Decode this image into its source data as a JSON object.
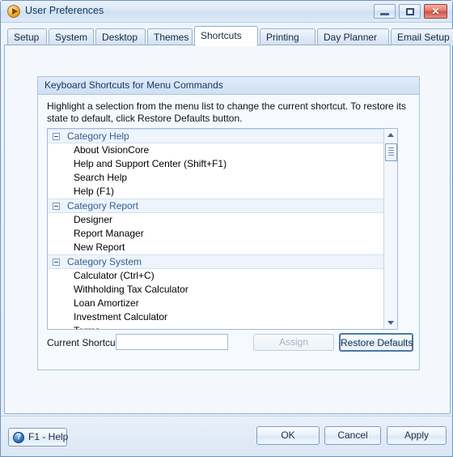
{
  "window": {
    "title": "User Preferences",
    "icon": "play-circle-icon",
    "controls": {
      "minimize": "minimize-icon",
      "maximize": "maximize-icon",
      "close": "✕"
    }
  },
  "tabs": [
    {
      "label": "Setup",
      "active": false
    },
    {
      "label": "System",
      "active": false
    },
    {
      "label": "Desktop",
      "active": false
    },
    {
      "label": "Themes",
      "active": false
    },
    {
      "label": "Shortcuts",
      "active": true
    },
    {
      "label": "Printing",
      "active": false
    },
    {
      "label": "Day Planner",
      "active": false
    },
    {
      "label": "Email Setup",
      "active": false
    }
  ],
  "groupbox": {
    "title": "Keyboard Shortcuts for Menu Commands",
    "description": "Highlight a selection from the menu list to change the current shortcut. To restore its state to default, click Restore Defaults button."
  },
  "tree": {
    "rows": [
      {
        "type": "category",
        "label": "Category Help"
      },
      {
        "type": "item",
        "label": "About VisionCore"
      },
      {
        "type": "item",
        "label": "Help and Support Center (Shift+F1)"
      },
      {
        "type": "item",
        "label": "Search Help"
      },
      {
        "type": "item",
        "label": "Help (F1)"
      },
      {
        "type": "category",
        "label": "Category Report"
      },
      {
        "type": "item",
        "label": "Designer"
      },
      {
        "type": "item",
        "label": "Report Manager"
      },
      {
        "type": "item",
        "label": "New Report"
      },
      {
        "type": "category",
        "label": "Category System"
      },
      {
        "type": "item",
        "label": "Calculator (Ctrl+C)"
      },
      {
        "type": "item",
        "label": "Withholding Tax Calculator"
      },
      {
        "type": "item",
        "label": "Loan Amortizer"
      },
      {
        "type": "item",
        "label": "Investment Calculator"
      },
      {
        "type": "item",
        "label": "Terms"
      }
    ]
  },
  "shortcut_bar": {
    "label": "Current Shortcut",
    "input_value": "",
    "input_placeholder": "",
    "assign_label": "Assign",
    "assign_enabled": false,
    "restore_label": "Restore Defaults"
  },
  "footer": {
    "help_label": "F1 - Help",
    "help_icon": "question-circle-icon",
    "ok_label": "OK",
    "cancel_label": "Cancel",
    "apply_label": "Apply"
  },
  "colors": {
    "window_bg": "#e3ecf7",
    "panel_bg": "#f4f8fd",
    "accent_blue": "#2f5f95",
    "group_header": "#cfe0f3",
    "close_red": "#cd5243"
  }
}
